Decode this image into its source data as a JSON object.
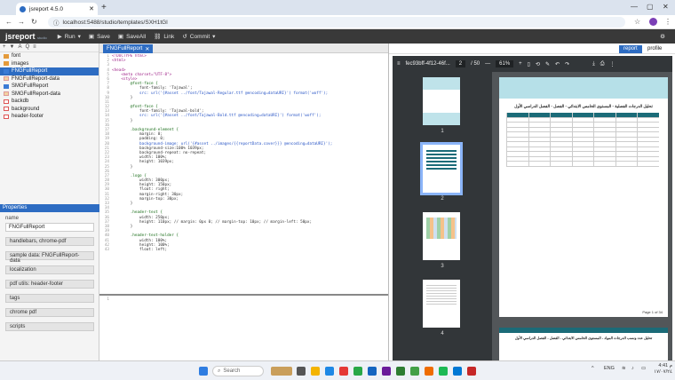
{
  "browser": {
    "tab_title": "jsreport 4.5.0",
    "url": "localhost:5488/studio/templates/SXH1tGl"
  },
  "toolbar": {
    "logo": "jsreport",
    "logo_sub": "studio",
    "run": "Run",
    "save": "Save",
    "save_all": "SaveAll",
    "link": "Link",
    "commit": "Commit"
  },
  "tree": [
    {
      "label": "font",
      "type": "folder"
    },
    {
      "label": "images",
      "type": "folder"
    },
    {
      "label": "FNGFullReport",
      "type": "tpl",
      "selected": true
    },
    {
      "label": "FNGFullReport-data",
      "type": "data"
    },
    {
      "label": "SMGFullReport",
      "type": "tpl"
    },
    {
      "label": "SMGFullReport-data",
      "type": "data"
    },
    {
      "label": "backdb",
      "type": "file"
    },
    {
      "label": "background",
      "type": "file"
    },
    {
      "label": "header-footer",
      "type": "file"
    }
  ],
  "properties": {
    "title": "Properties",
    "name_label": "name",
    "name_value": "FNGFullReport",
    "buttons": [
      "handlebars, chrome-pdf",
      "sample data: FNGFullReport-data",
      "localization",
      "pdf utils: header-footer",
      "tags",
      "chrome pdf",
      "scripts"
    ]
  },
  "editor": {
    "tab": "FNGFullReport",
    "lines": [
      {
        "n": "1",
        "t": "<!DOCTYPE html>",
        "k": "tag"
      },
      {
        "n": "2",
        "t": "<html>",
        "k": "tag"
      },
      {
        "n": "3",
        "t": "",
        "k": ""
      },
      {
        "n": "4",
        "t": "<head>",
        "k": "tag"
      },
      {
        "n": "5",
        "t": "    <meta charset=\"UTF-8\">",
        "k": "tag"
      },
      {
        "n": "6",
        "t": "    <style>",
        "k": "tag"
      },
      {
        "n": "7",
        "t": "        @font-face {",
        "k": "prop"
      },
      {
        "n": "8",
        "t": "            font-family: 'Tajawal';",
        "k": ""
      },
      {
        "n": "9",
        "t": "            src: url('{#asset ../font/Tajawal-Regular.ttf @encoding=dataURI}') format('woff');",
        "k": "str"
      },
      {
        "n": "10",
        "t": "        }",
        "k": ""
      },
      {
        "n": "11",
        "t": "",
        "k": ""
      },
      {
        "n": "12",
        "t": "        @font-face {",
        "k": "prop"
      },
      {
        "n": "13",
        "t": "            font-family: 'Tajawal-bold';",
        "k": ""
      },
      {
        "n": "14",
        "t": "            src: url('{#asset ../font/Tajawal-Bold.ttf @encoding=dataURI}') format('woff');",
        "k": "str"
      },
      {
        "n": "15",
        "t": "        }",
        "k": ""
      },
      {
        "n": "16",
        "t": "",
        "k": ""
      },
      {
        "n": "17",
        "t": "        .background-element {",
        "k": "prop"
      },
      {
        "n": "18",
        "t": "            margin: 0;",
        "k": ""
      },
      {
        "n": "19",
        "t": "            padding: 0;",
        "k": ""
      },
      {
        "n": "20",
        "t": "            background-image: url('{#asset ../images/{{reportData.cover}}} @encoding=dataURI}');",
        "k": "str"
      },
      {
        "n": "21",
        "t": "            background-size:100% 1039px;",
        "k": ""
      },
      {
        "n": "22",
        "t": "            background-repeat: no-repeat;",
        "k": ""
      },
      {
        "n": "23",
        "t": "            width: 100%;",
        "k": ""
      },
      {
        "n": "24",
        "t": "            height: 1039px;",
        "k": ""
      },
      {
        "n": "25",
        "t": "        }",
        "k": ""
      },
      {
        "n": "26",
        "t": "",
        "k": ""
      },
      {
        "n": "27",
        "t": "        .logo {",
        "k": "prop"
      },
      {
        "n": "28",
        "t": "            width: 300px;",
        "k": ""
      },
      {
        "n": "29",
        "t": "            height: 150px;",
        "k": ""
      },
      {
        "n": "30",
        "t": "            float: right;",
        "k": ""
      },
      {
        "n": "31",
        "t": "            margin-right: 30px;",
        "k": ""
      },
      {
        "n": "32",
        "t": "            margin-top: 30px;",
        "k": ""
      },
      {
        "n": "33",
        "t": "        }",
        "k": ""
      },
      {
        "n": "34",
        "t": "",
        "k": ""
      },
      {
        "n": "35",
        "t": "        .header-text {",
        "k": "prop"
      },
      {
        "n": "36",
        "t": "            width: 250px;",
        "k": ""
      },
      {
        "n": "37",
        "t": "            height: 110px; // margin: 0px 0; // margin-top: 10px; // margin-left: 50px;",
        "k": ""
      },
      {
        "n": "38",
        "t": "        }",
        "k": ""
      },
      {
        "n": "39",
        "t": "",
        "k": ""
      },
      {
        "n": "40",
        "t": "        .header-text-holder {",
        "k": "prop"
      },
      {
        "n": "41",
        "t": "            width: 100%;",
        "k": ""
      },
      {
        "n": "42",
        "t": "            height: 100%;",
        "k": ""
      },
      {
        "n": "43",
        "t": "            float: left;",
        "k": ""
      }
    ],
    "helpers_line": "1"
  },
  "preview": {
    "tabs": [
      "report",
      "profile"
    ],
    "file_name": "fec93bff-4f12-46f...",
    "page": "2",
    "page_total": "/ 50",
    "zoom": "61%",
    "thumb_numbers": [
      "1",
      "2",
      "3",
      "4"
    ],
    "doc_title": "تحليل الدرجات الفصلية - المستوى الخامس الابتدائي - الفصل - الفصل الدراسي الأول",
    "page_footer": "Page 1 of 34",
    "page2_title": "تحليل عدد ونسب الدرجات المواد - المستوى الخامس الابتدائي - الفصل - الفصل الدراسي الأول"
  },
  "taskbar": {
    "search": "Search",
    "lang": "ENG",
    "time": "4:41 م",
    "date": "١٧/٠٧/٢٤"
  }
}
